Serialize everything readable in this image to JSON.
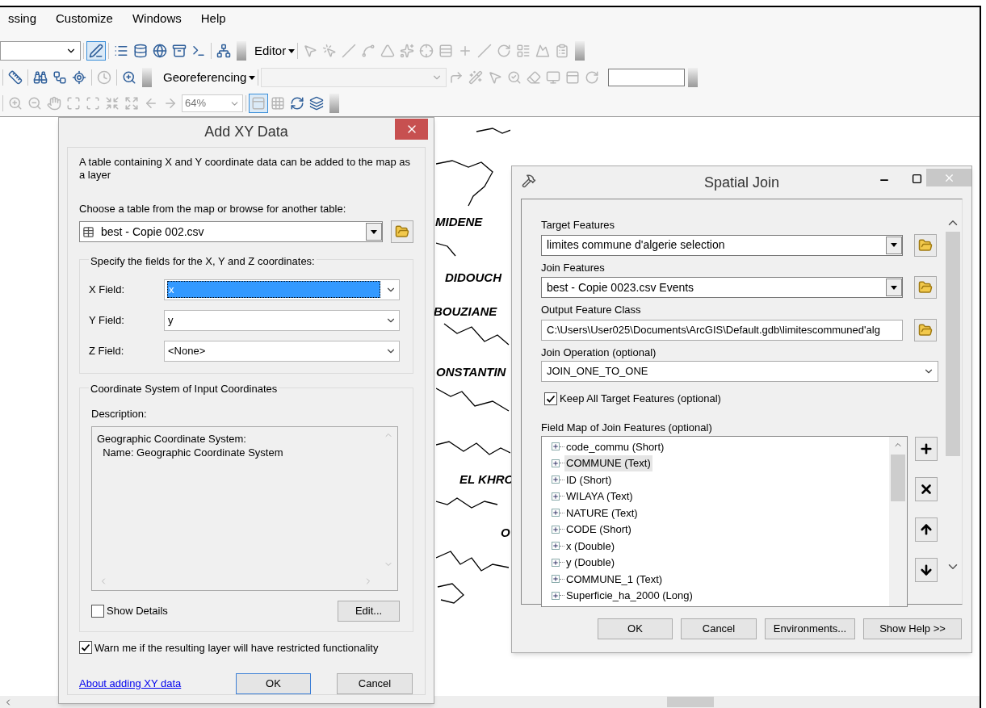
{
  "menu_bar": [
    {
      "label": "ssing"
    },
    {
      "label": "Customize"
    },
    {
      "label": "Windows"
    },
    {
      "label": "Help"
    }
  ],
  "toolbars": {
    "editor_label": "Editor",
    "georeferencing_label": "Georeferencing",
    "zoom_value": "64%"
  },
  "map_labels": [
    {
      "text": "MIDENE"
    },
    {
      "text": "DIDOUCH"
    },
    {
      "text": "BOUZIANE"
    },
    {
      "text": "ONSTANTIN"
    },
    {
      "text": "EL KHRO"
    },
    {
      "text": "O"
    }
  ],
  "add_xy_dialog": {
    "title": "Add XY Data",
    "intro": "A table containing X and Y coordinate data can be added to the map as a layer",
    "choose_label": "Choose a table from the map or browse for another table:",
    "table_value": "best - Copie 002.csv",
    "fields_group_title": "Specify the fields for the X, Y and Z coordinates:",
    "fields": [
      {
        "label": "X Field:",
        "value": "x",
        "selected": true
      },
      {
        "label": "Y Field:",
        "value": "y",
        "selected": false
      },
      {
        "label": "Z Field:",
        "value": "<None>",
        "selected": false
      }
    ],
    "coord_group_title": "Coordinate System of Input Coordinates",
    "description_label": "Description:",
    "description_lines": [
      "Geographic Coordinate System:",
      "  Name: Geographic Coordinate System"
    ],
    "show_details": {
      "label": "Show Details",
      "checked": false
    },
    "edit_button": "Edit...",
    "warn": {
      "label": "Warn me if the resulting layer will have restricted functionality",
      "checked": true
    },
    "help_link": "About adding XY data",
    "ok_button": "OK",
    "cancel_button": "Cancel"
  },
  "spatial_join": {
    "title": "Spatial Join",
    "params": [
      {
        "label": "Target Features",
        "value": "limites commune d'algerie selection",
        "kind": "dropdown"
      },
      {
        "label": "Join Features",
        "value": "best - Copie 0023.csv Events",
        "kind": "dropdown"
      },
      {
        "label": "Output Feature Class",
        "value": "C:\\Users\\User025\\Documents\\ArcGIS\\Default.gdb\\limitescommuned'alg",
        "kind": "path"
      },
      {
        "label": "Join Operation (optional)",
        "value": "JOIN_ONE_TO_ONE",
        "kind": "combo"
      }
    ],
    "keep_all": {
      "label": "Keep All Target Features (optional)",
      "checked": true
    },
    "field_map_label": "Field Map of Join Features (optional)",
    "field_map_items": [
      {
        "label": "code_commu (Short)",
        "selected": false
      },
      {
        "label": "COMMUNE (Text)",
        "selected": true
      },
      {
        "label": "ID (Short)",
        "selected": false
      },
      {
        "label": "WILAYA (Text)",
        "selected": false
      },
      {
        "label": "NATURE (Text)",
        "selected": false
      },
      {
        "label": "CODE (Short)",
        "selected": false
      },
      {
        "label": "x (Double)",
        "selected": false
      },
      {
        "label": "y (Double)",
        "selected": false
      },
      {
        "label": "COMMUNE_1 (Text)",
        "selected": false
      },
      {
        "label": "Superficie_ha_2000 (Long)",
        "selected": false
      }
    ],
    "buttons": [
      {
        "label": "OK"
      },
      {
        "label": "Cancel"
      },
      {
        "label": "Environments..."
      },
      {
        "label": "Show Help >>"
      }
    ]
  }
}
